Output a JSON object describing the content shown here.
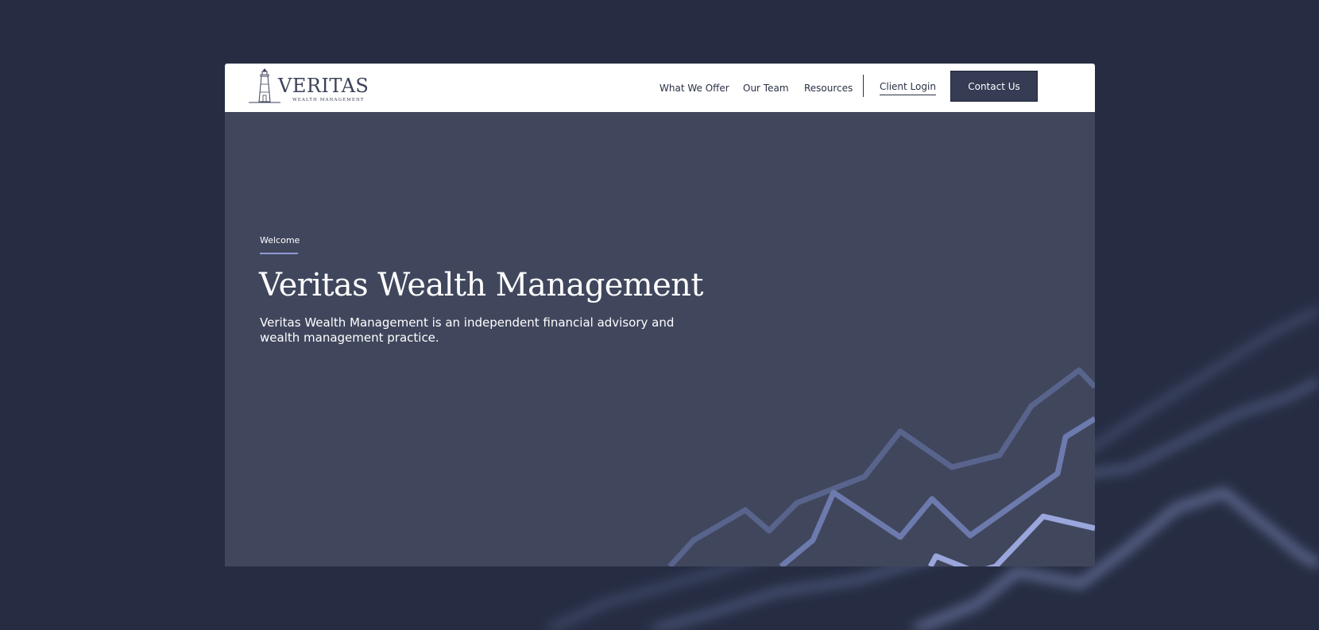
{
  "brand": {
    "name": "VERITAS",
    "tagline": "WEALTH MANAGEMENT",
    "logo_icon": "lighthouse-icon"
  },
  "nav": {
    "items": [
      {
        "label": "What We Offer"
      },
      {
        "label": "Our Team"
      },
      {
        "label": "Resources"
      }
    ],
    "login_label": "Client Login",
    "contact_label": "Contact Us"
  },
  "hero": {
    "eyebrow": "Welcome",
    "title": "Veritas Wealth Management",
    "description": "Veritas Wealth Management is an independent financial advisory and wealth management practice."
  },
  "colors": {
    "page_background": "#262d43",
    "hero_background": "#40475d",
    "navbar_background": "#ffffff",
    "accent": "#8f9ad8",
    "button_background": "#353c53"
  }
}
